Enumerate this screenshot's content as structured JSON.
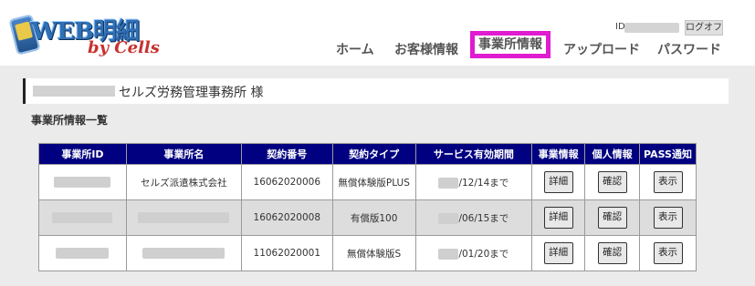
{
  "logo": {
    "title": "WEB明細",
    "subtitle": "by Cells"
  },
  "user": {
    "id_label": "ID",
    "logout_label": "ログオフ"
  },
  "nav": [
    {
      "label": "ホーム",
      "active": false
    },
    {
      "label": "お客様情報",
      "active": false
    },
    {
      "label": "事業所情報",
      "active": true
    },
    {
      "label": "アップロード",
      "active": false
    },
    {
      "label": "パスワード",
      "active": false
    }
  ],
  "heading": {
    "title": "セルズ労務管理事務所 様"
  },
  "section": {
    "title": "事業所情報一覧"
  },
  "table": {
    "headers": [
      "事業所ID",
      "事業所名",
      "契約番号",
      "契約タイプ",
      "サービス有効期間",
      "事業情報",
      "個人情報",
      "PASS通知"
    ],
    "rows": [
      {
        "office_name": "セルズ派遣株式会社",
        "contract_no": "16062020006",
        "contract_type": "無償体験版PLUS",
        "period": "/12/14まで",
        "detail": "詳細",
        "confirm": "確認",
        "show": "表示"
      },
      {
        "office_name": "",
        "contract_no": "16062020008",
        "contract_type": "有償版100",
        "period": "/06/15まで",
        "detail": "詳細",
        "confirm": "確認",
        "show": "表示"
      },
      {
        "office_name": "",
        "contract_no": "11062020001",
        "contract_type": "無償体験版S",
        "period": "/01/20まで",
        "detail": "詳細",
        "confirm": "確認",
        "show": "表示"
      }
    ]
  },
  "colors": {
    "header_bg": "#000080",
    "highlight": "#e01bd0",
    "logo_red": "#c8312e",
    "logo_blue": "#2f6fb5"
  }
}
